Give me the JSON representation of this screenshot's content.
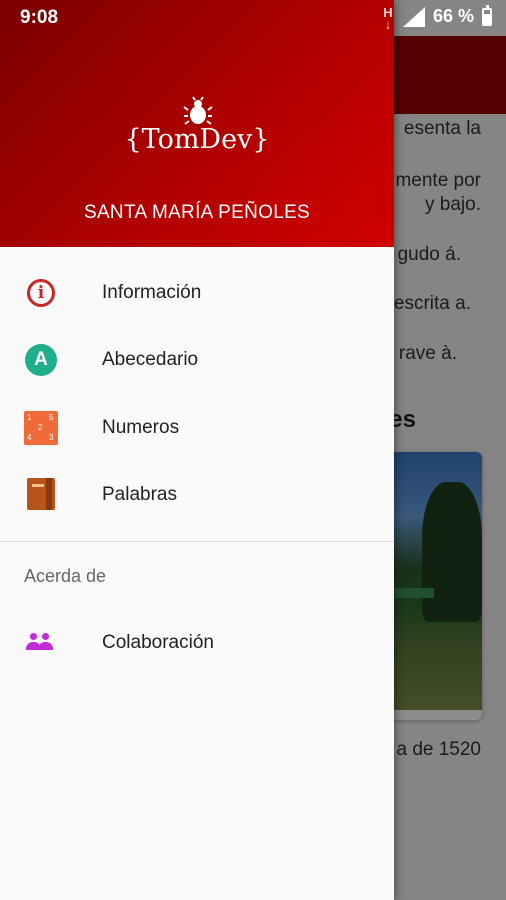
{
  "status_bar": {
    "time": "9:08",
    "battery": "66 %",
    "icons": [
      "h-notification-icon",
      "signal-icon",
      "battery-icon"
    ]
  },
  "background": {
    "lines": [
      "esenta la",
      "mente por",
      "y bajo.",
      "gudo á.",
      "escrita a.",
      "rave à."
    ],
    "heading": "es",
    "caption": "a de 1520"
  },
  "drawer": {
    "logo_text": "{TomDev}",
    "title": "SANTA MARÍA PEÑOLES",
    "items": [
      {
        "label": "Información",
        "icon": "info-icon"
      },
      {
        "label": "Abecedario",
        "icon": "alphabet-icon"
      },
      {
        "label": "Numeros",
        "icon": "numbers-icon"
      },
      {
        "label": "Palabras",
        "icon": "book-icon"
      }
    ],
    "section_label": "Acerda de",
    "about_items": [
      {
        "label": "Colaboración",
        "icon": "people-icon"
      }
    ]
  },
  "colors": {
    "header_dark": "#7a0000",
    "header_light": "#d00000",
    "accent_teal": "#1fae8c",
    "accent_purple": "#c22bd6"
  }
}
